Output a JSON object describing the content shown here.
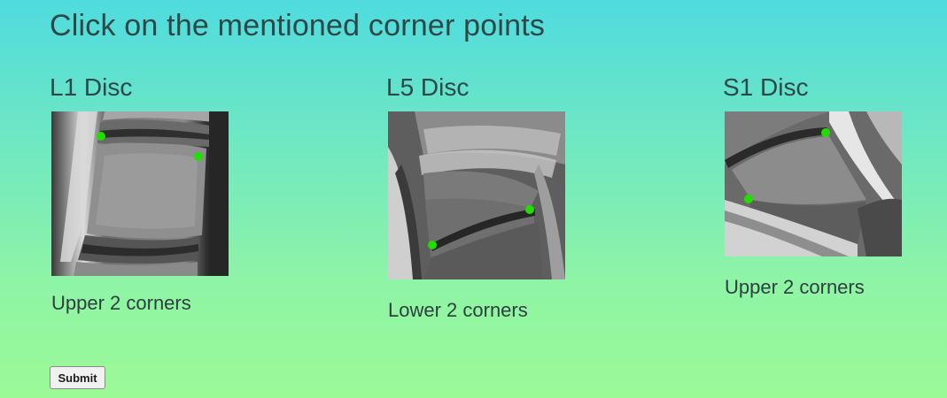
{
  "page": {
    "title": "Click on the mentioned corner points"
  },
  "panels": [
    {
      "title": "L1 Disc",
      "instruction": "Upper 2 corners"
    },
    {
      "title": "L5 Disc",
      "instruction": "Lower 2 corners"
    },
    {
      "title": "S1 Disc",
      "instruction": "Upper 2 corners"
    }
  ],
  "form": {
    "submit_label": "Submit"
  },
  "colors": {
    "background_top": "#4fdbdf",
    "background_bottom": "#9bfa96",
    "marker": "#22dd00"
  },
  "markers_per_panel": 2
}
